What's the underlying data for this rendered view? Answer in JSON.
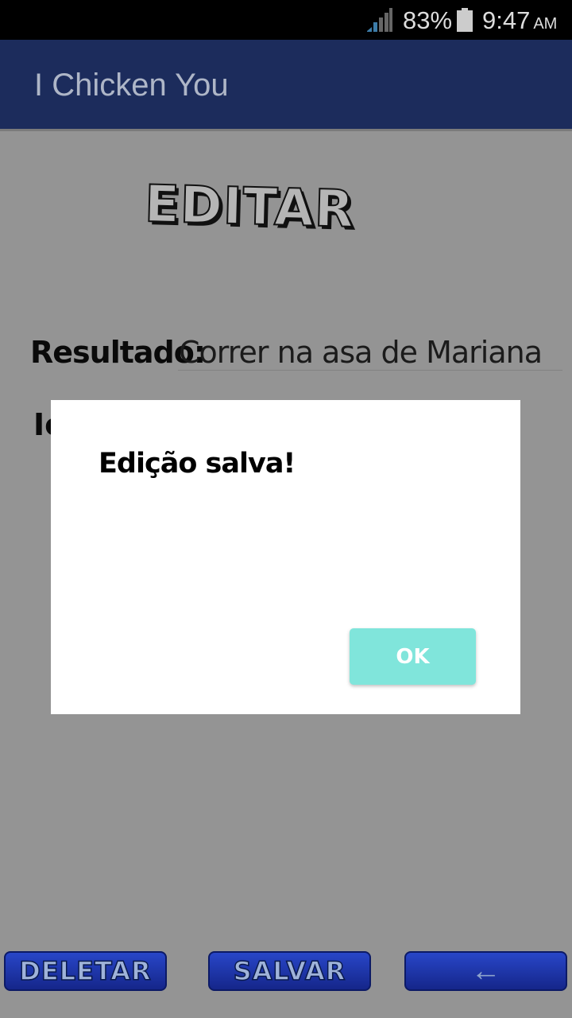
{
  "status_bar": {
    "battery": "83%",
    "time": "9:47",
    "ampm": "AM",
    "icons": [
      "signal-icon",
      "battery-icon"
    ]
  },
  "app_bar": {
    "title": "I Chicken You"
  },
  "main": {
    "heading": "EDITAR",
    "result_label": "Resultado:",
    "result_value": "Correr na asa de Mariana",
    "second_label_partial": "Ic"
  },
  "dialog": {
    "message": "Edição salva!",
    "ok_label": "OK",
    "ok_color": "#80e5db"
  },
  "bottom_bar": {
    "delete_label": "DELETAR",
    "save_label": "SALVAR",
    "back_icon": "←"
  },
  "colors": {
    "app_bar": "#1c2c5c",
    "overlay": "#949494",
    "buttons": "#2846c8"
  }
}
